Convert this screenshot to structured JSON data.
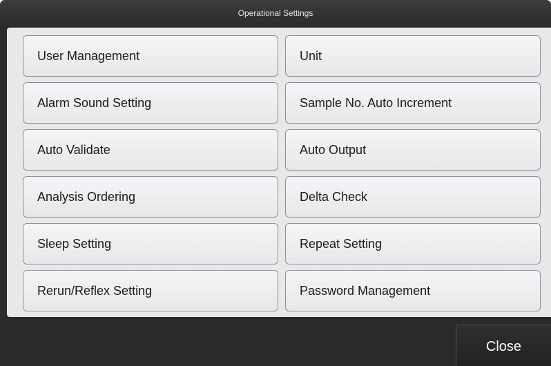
{
  "dialog": {
    "title": "Operational Settings",
    "close_label": "Close"
  },
  "settings": {
    "left": [
      "User Management",
      "Alarm Sound Setting",
      "Auto Validate",
      "Analysis Ordering",
      "Sleep Setting",
      "Rerun/Reflex Setting"
    ],
    "right": [
      "Unit",
      "Sample No. Auto Increment",
      "Auto Output",
      "Delta Check",
      "Repeat Setting",
      "Password Management"
    ]
  }
}
